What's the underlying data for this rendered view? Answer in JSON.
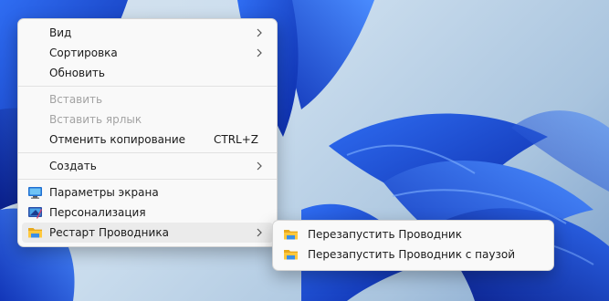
{
  "context_menu": {
    "items": [
      {
        "label": "Вид"
      },
      {
        "label": "Сортировка"
      },
      {
        "label": "Обновить"
      },
      {
        "label": "Вставить"
      },
      {
        "label": "Вставить ярлык"
      },
      {
        "label": "Отменить копирование",
        "shortcut": "CTRL+Z"
      },
      {
        "label": "Создать"
      },
      {
        "label": "Параметры экрана",
        "icon": "display-icon"
      },
      {
        "label": "Персонализация",
        "icon": "personalize-icon"
      },
      {
        "label": "Рестарт Проводника",
        "icon": "folder-icon"
      }
    ]
  },
  "submenu": {
    "items": [
      {
        "label": "Перезапустить Проводник",
        "icon": "folder-icon"
      },
      {
        "label": "Перезапустить Проводник с паузой",
        "icon": "folder-icon"
      }
    ]
  },
  "colors": {
    "menu_background": "#f9f9f9",
    "hover_background": "#ebebeb",
    "disabled_text": "#a3a3a3",
    "wallpaper_blue": "#1f4fd6"
  }
}
